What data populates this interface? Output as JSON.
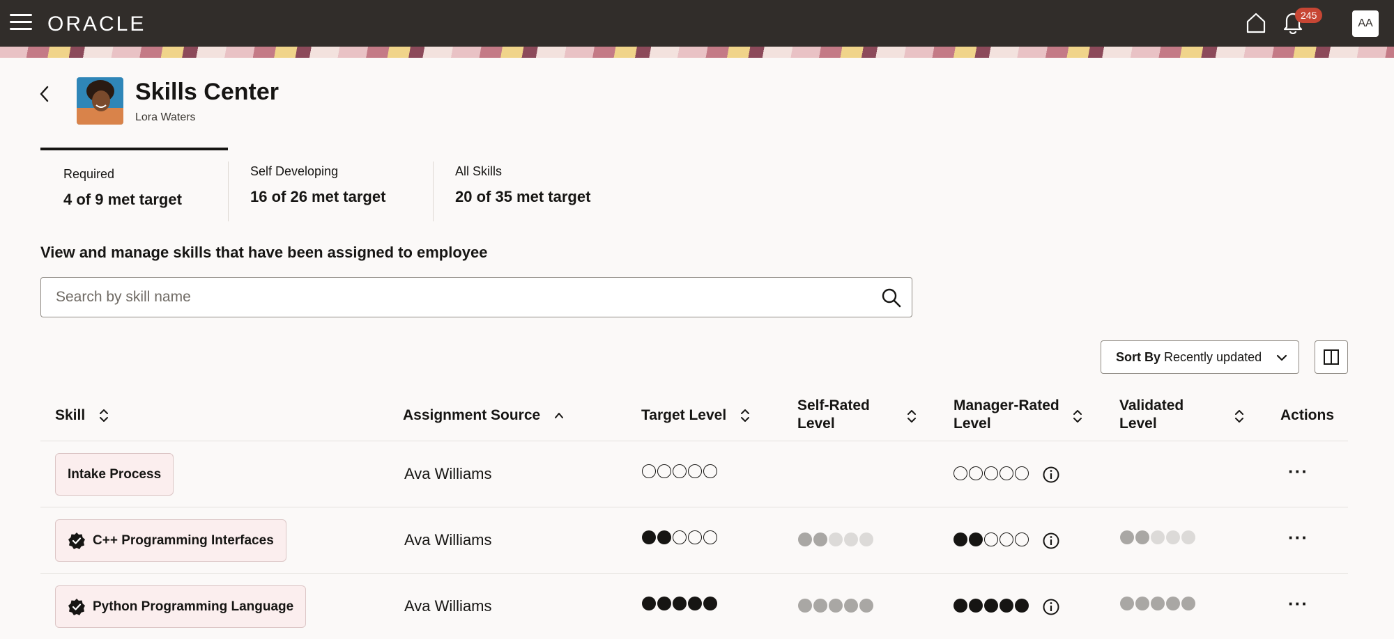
{
  "header": {
    "brand": "ORACLE",
    "notification_count": "245",
    "user_initials": "AA"
  },
  "page": {
    "title": "Skills Center",
    "subtitle": "Lora Waters"
  },
  "summary_tabs": [
    {
      "label": "Required",
      "value": "4 of 9 met target"
    },
    {
      "label": "Self Developing",
      "value": "16 of 26 met target"
    },
    {
      "label": "All Skills",
      "value": "20 of 35 met target"
    }
  ],
  "section_title": "View and manage skills that have been assigned to employee",
  "search": {
    "placeholder": "Search by skill name"
  },
  "sort": {
    "prefix": "Sort By",
    "value": "Recently updated"
  },
  "columns": {
    "skill": "Skill",
    "assignment_source": "Assignment Source",
    "target_level": "Target Level",
    "self_rated_line1": "Self-Rated",
    "self_rated_line2": "Level",
    "manager_rated_line1": "Manager-Rated",
    "manager_rated_line2": "Level",
    "validated_line1": "Validated",
    "validated_line2": "Level",
    "actions": "Actions"
  },
  "rows": [
    {
      "skill": "Intake Process",
      "verified": false,
      "source": "Ava Williams",
      "target": 0,
      "self_rated": null,
      "manager_rated": 0,
      "validated": null,
      "actions": "···"
    },
    {
      "skill": "C++ Programming Interfaces",
      "verified": true,
      "source": "Ava Williams",
      "target": 2,
      "self_rated": 2,
      "manager_rated": 2,
      "validated": 2,
      "actions": "···"
    },
    {
      "skill": "Python Programming Language",
      "verified": true,
      "source": "Ava Williams",
      "target": 5,
      "self_rated": 5,
      "manager_rated": 5,
      "validated": 5,
      "actions": "···"
    }
  ],
  "icons": {
    "menu": "hamburger-menu-icon",
    "home": "home-icon",
    "notifications": "bell-icon",
    "back": "chevron-left-icon",
    "search": "search-icon",
    "sort_dropdown": "chevron-down-icon",
    "columns": "column-layout-icon",
    "info": "info-icon",
    "verified": "verified-badge-icon"
  },
  "colors": {
    "topbar": "#312d2a",
    "badge": "#c74634",
    "chip_bg": "#fbeeee",
    "dot_filled": "#161513",
    "dot_gray": "#a9a7a4"
  }
}
